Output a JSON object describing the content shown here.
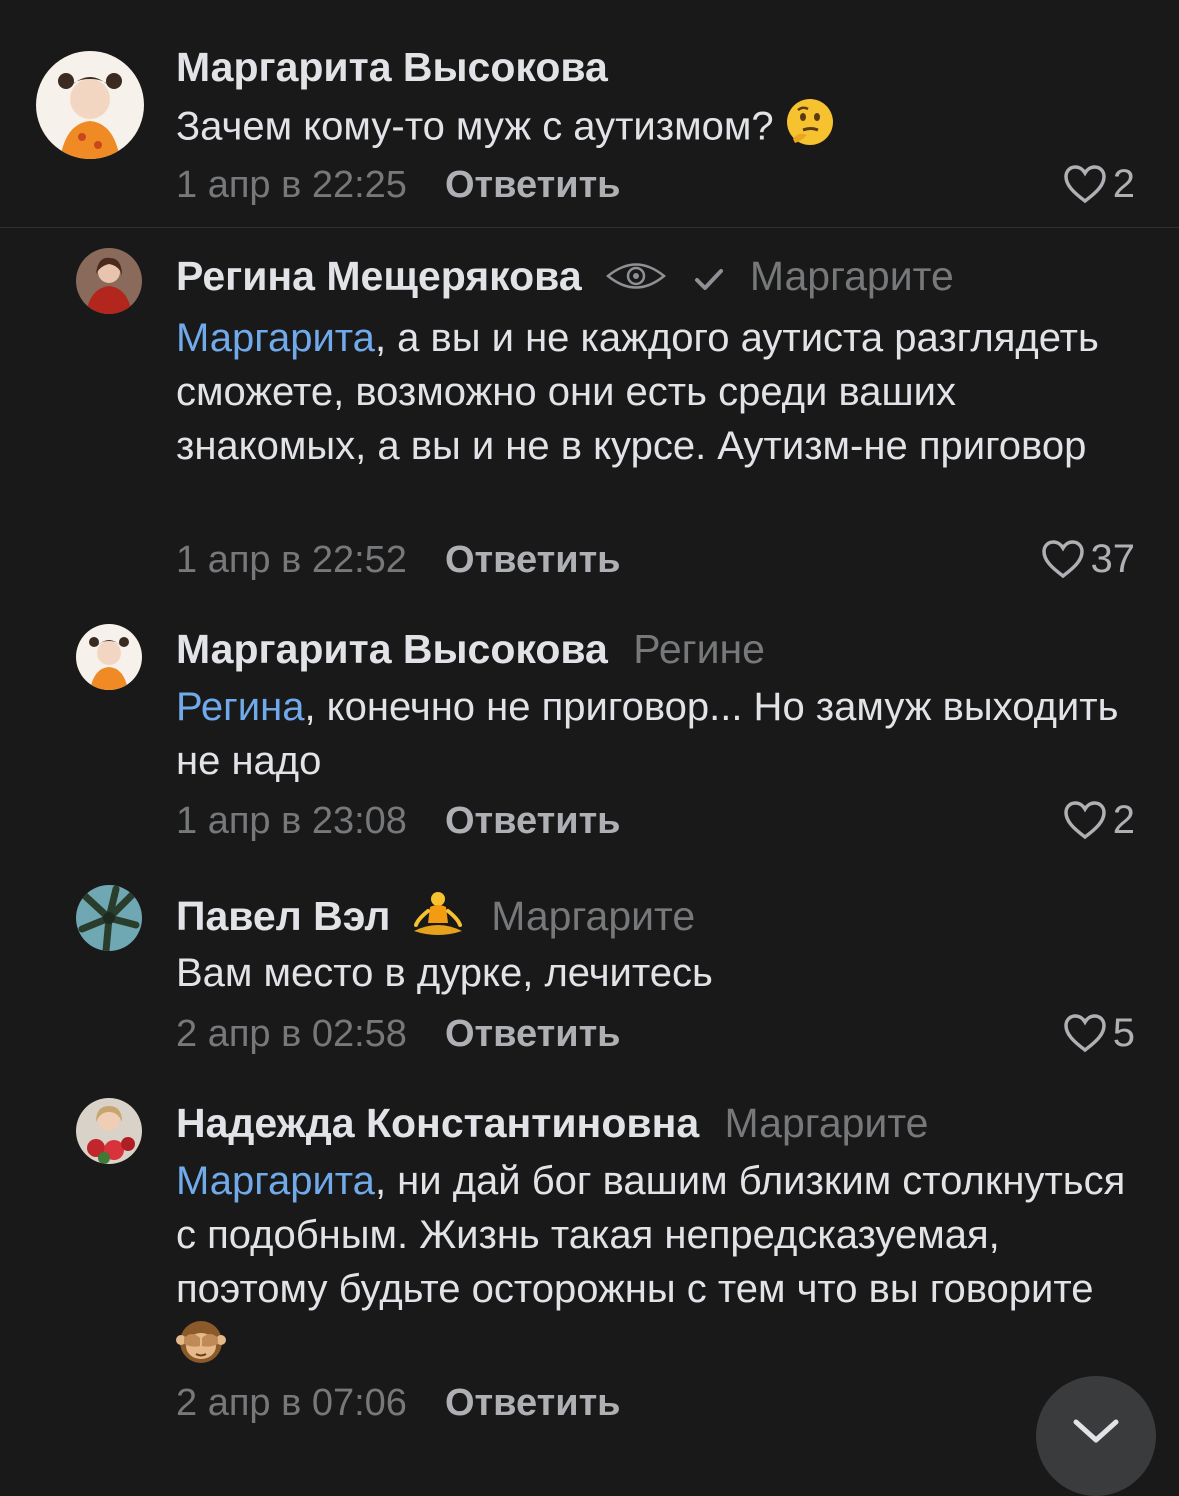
{
  "comments": [
    {
      "author": "Маргарита Высокова",
      "reply_to": "",
      "mention": "",
      "text": "Зачем кому-то муж с аутизмом?",
      "emoji": "thinking-face",
      "date": "1 апр в 22:25",
      "reply_label": "Ответить",
      "likes": "2"
    },
    {
      "author": "Регина Мещерякова",
      "reply_to": "Маргарите",
      "mention": "Маргарита",
      "text": ", а вы и не каждого аутиста разглядеть сможете, возможно они есть среди ваших знакомых, а вы и не в курсе. Аутизм-не приговор",
      "date": "1 апр в 22:52",
      "reply_label": "Ответить",
      "likes": "37"
    },
    {
      "author": "Маргарита Высокова",
      "reply_to": "Регине",
      "mention": "Регина",
      "text": ", конечно не приговор... Но замуж выходить не надо",
      "date": "1 апр в 23:08",
      "reply_label": "Ответить",
      "likes": "2"
    },
    {
      "author": "Павел Вэл",
      "author_emoji": "person-in-lotus-position",
      "reply_to": "Маргарите",
      "mention": "",
      "text": "Вам место в дурке, лечитесь",
      "date": "2 апр в 02:58",
      "reply_label": "Ответить",
      "likes": "5"
    },
    {
      "author": "Надежда Константиновна",
      "reply_to": "Маргарите",
      "mention": "Маргарита",
      "text": ", ни дай бог вашим близким столкнуться с подобным. Жизнь такая непредсказуемая, поэтому будьте осторожны с тем что вы говорите",
      "emoji": "see-no-evil-monkey",
      "date": "2 апр в 07:06",
      "reply_label": "Ответить",
      "likes": ""
    }
  ],
  "colors": {
    "background": "#19191a",
    "mention": "#71aaeb",
    "secondary_text": "#76787a",
    "primary_text": "#e1e3e6"
  }
}
